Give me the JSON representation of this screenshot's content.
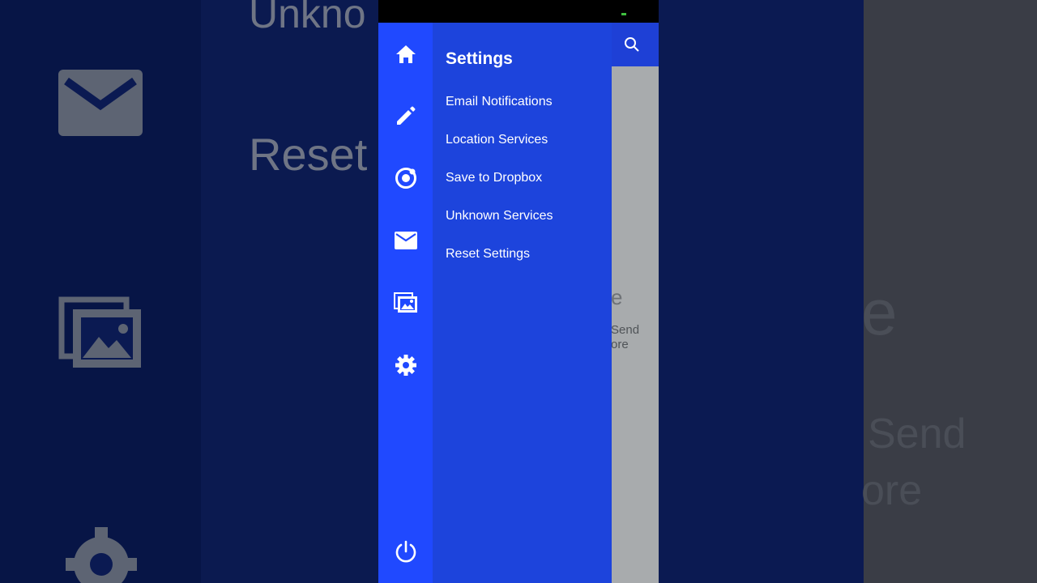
{
  "menu": {
    "title": "Settings",
    "items": [
      {
        "label": "Email Notifications"
      },
      {
        "label": "Location Services"
      },
      {
        "label": "Save to Dropbox"
      },
      {
        "label": "Unknown Services"
      },
      {
        "label": "Reset Settings"
      }
    ]
  },
  "rail": {
    "icons": [
      "home-icon",
      "pencil-icon",
      "ionic-icon",
      "mail-icon",
      "images-icon",
      "gear-icon",
      "power-icon"
    ]
  },
  "content": {
    "heading_fragment": "e",
    "body_line1": "Send",
    "body_line2": "ore"
  },
  "background": {
    "left_top_text": "Unkno",
    "left_mid_text": "Reset",
    "right_heading": "e",
    "right_line1": "Send",
    "right_line2": "ore"
  },
  "colors": {
    "rail": "#2049ff",
    "menu": "#1d44dc",
    "header": "#1e40d6",
    "content": "#a8abad"
  }
}
